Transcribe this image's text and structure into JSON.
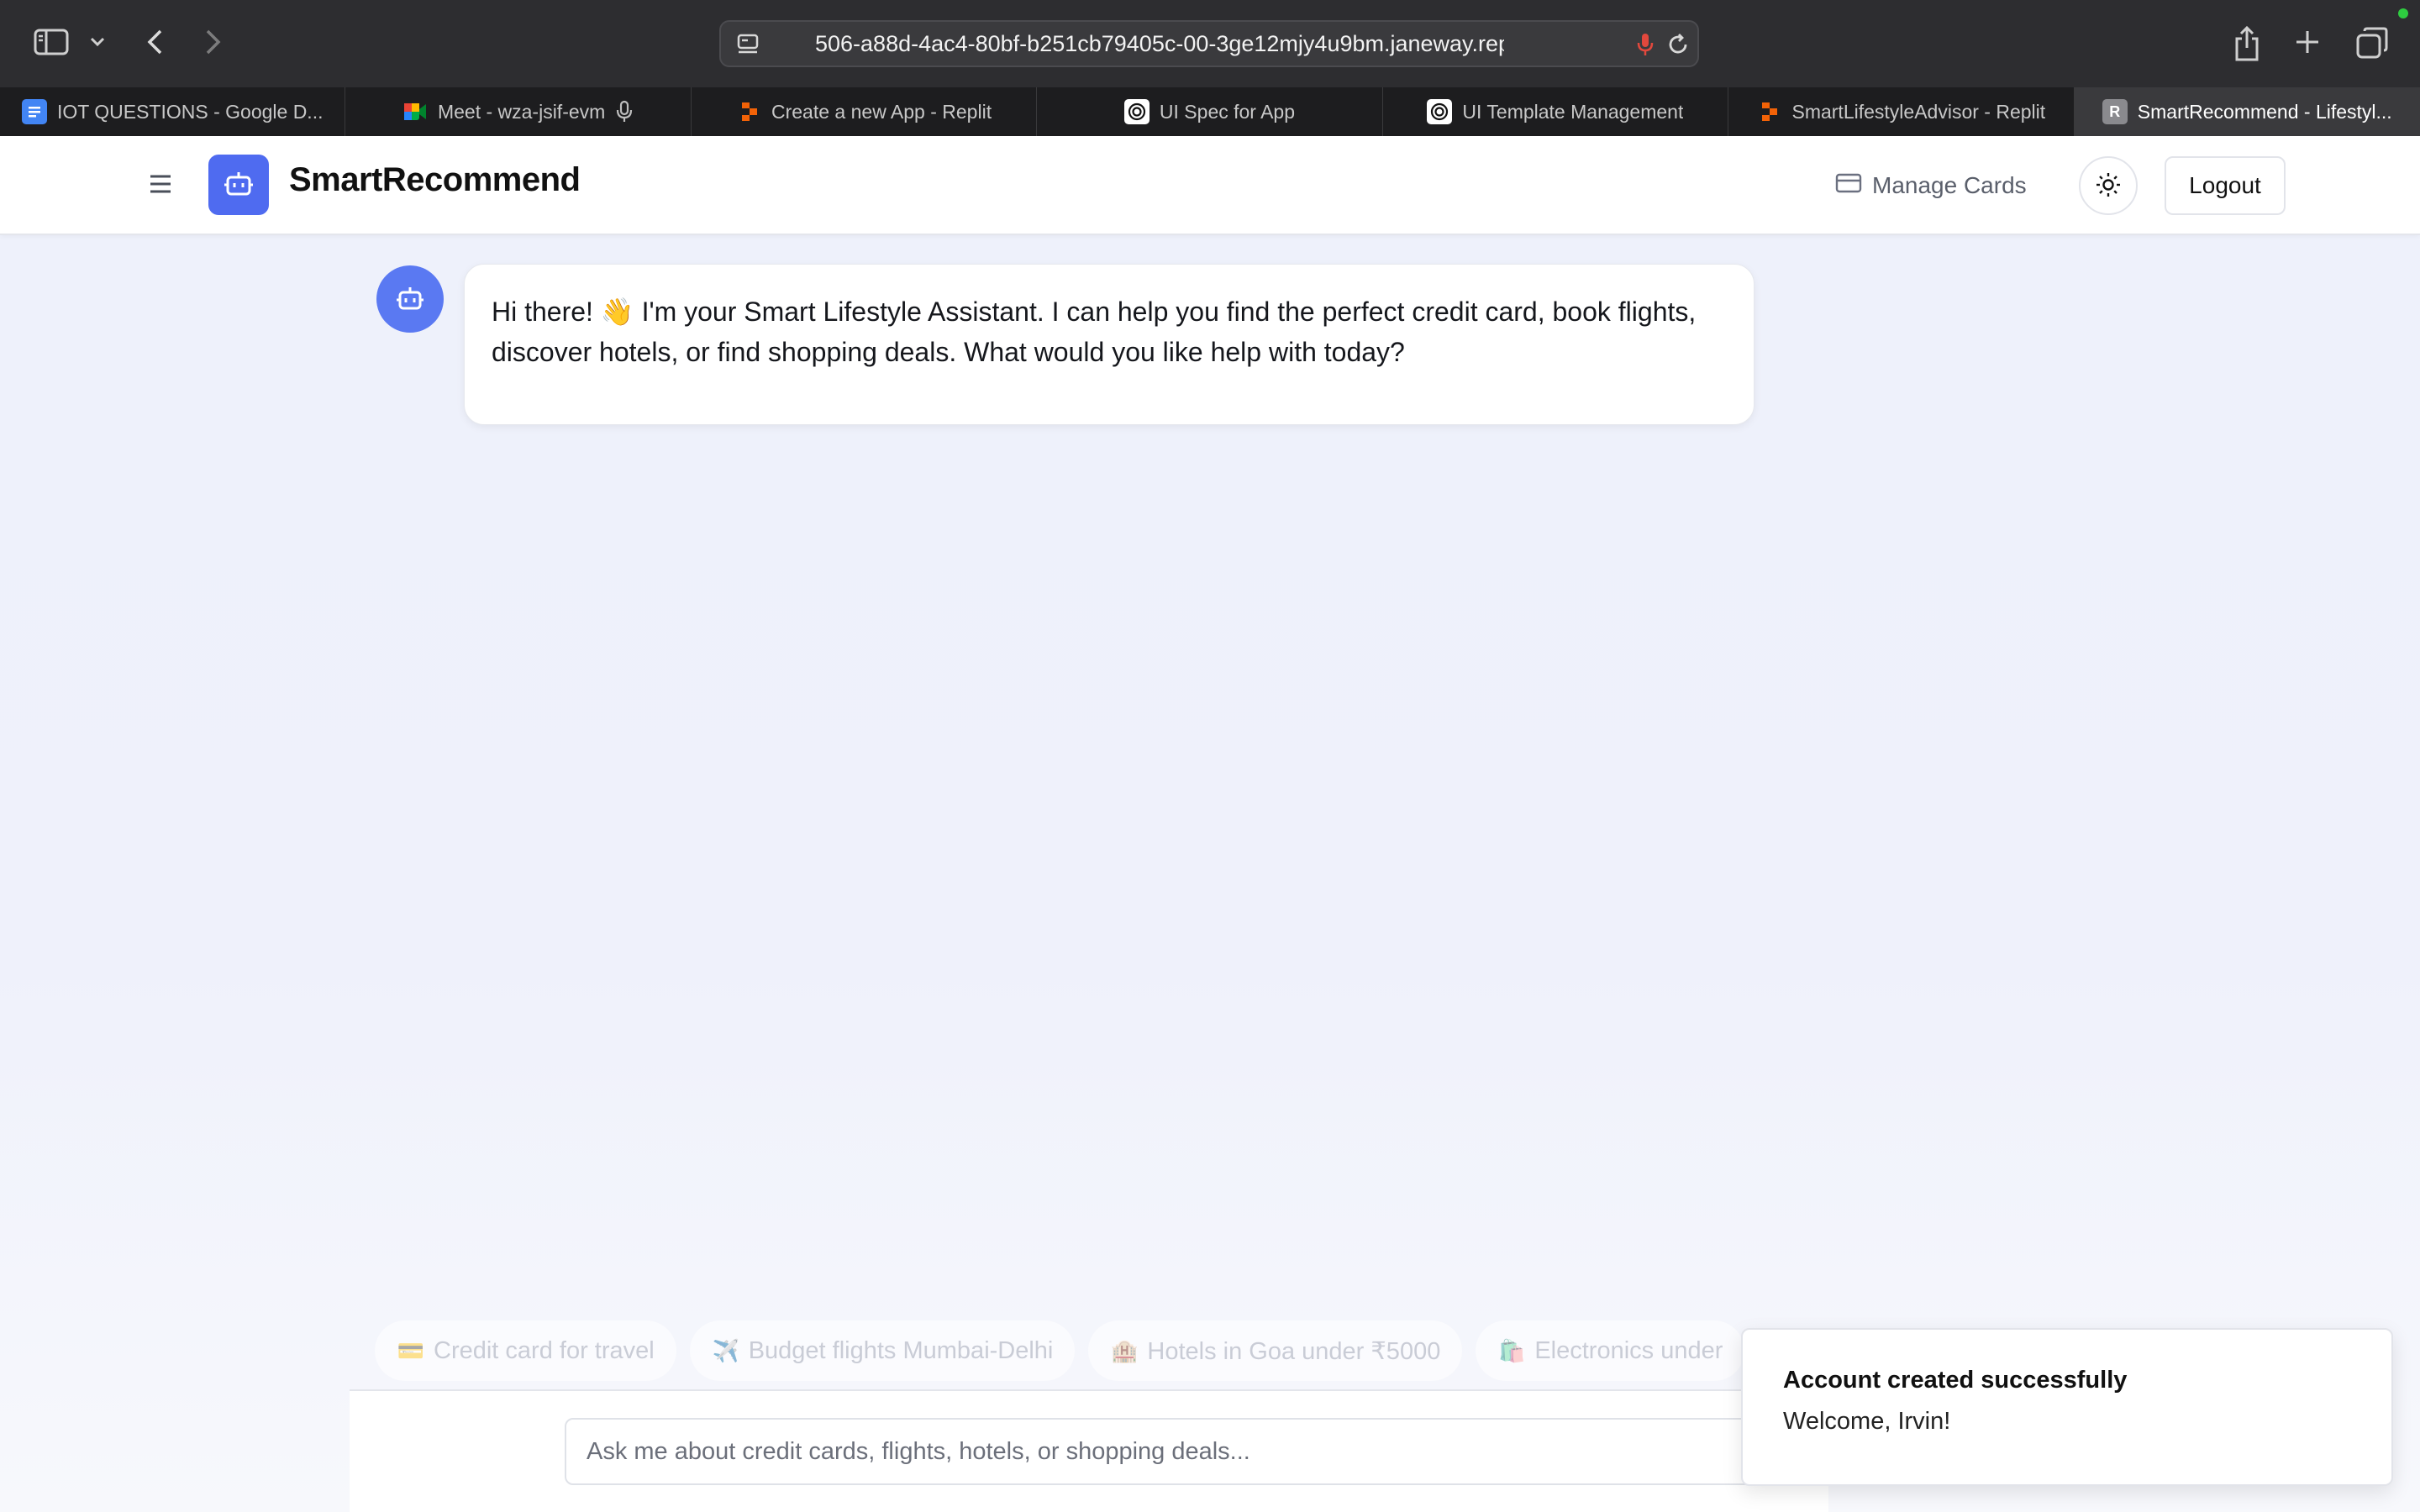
{
  "browser": {
    "url": "506-a88d-4ac4-80bf-b251cb79405c-00-3ge12mjy4u9bm.janeway.replit.dev",
    "tabs": [
      {
        "label": "IOT QUESTIONS - Google D...",
        "icon": "google-docs-icon",
        "active": false
      },
      {
        "label": "Meet - wza-jsif-evm",
        "icon": "google-meet-icon",
        "active": false
      },
      {
        "label": "Create a new App - Replit",
        "icon": "replit-icon",
        "active": false
      },
      {
        "label": "UI Spec for App",
        "icon": "openai-icon",
        "active": false
      },
      {
        "label": "UI Template Management",
        "icon": "openai-icon",
        "active": false
      },
      {
        "label": "SmartLifestyleAdvisor - Replit",
        "icon": "replit-icon",
        "active": false
      },
      {
        "label": "SmartRecommend - Lifestyl...",
        "icon": "r-letter-icon",
        "active": true
      }
    ],
    "tab_icon_letter": "R"
  },
  "app": {
    "brand": "SmartRecommend",
    "manage_cards": "Manage Cards",
    "logout": "Logout",
    "accent_color": "#4f6bf0"
  },
  "chat": {
    "bot_message": "Hi there! 👋 I'm your Smart Lifestyle Assistant. I can help you find the perfect credit card, book flights, discover hotels, or find shopping deals. What would you like help with today?",
    "suggestions": [
      {
        "icon": "💳",
        "label": "Credit card for travel"
      },
      {
        "icon": "✈️",
        "label": "Budget flights Mumbai-Delhi"
      },
      {
        "icon": "🏨",
        "label": "Hotels in Goa under ₹5000"
      },
      {
        "icon": "🛍️",
        "label": "Electronics under"
      }
    ],
    "input_placeholder": "Ask me about credit cards, flights, hotels, or shopping deals..."
  },
  "toast": {
    "title": "Account created successfully",
    "description": "Welcome, Irvin!"
  }
}
